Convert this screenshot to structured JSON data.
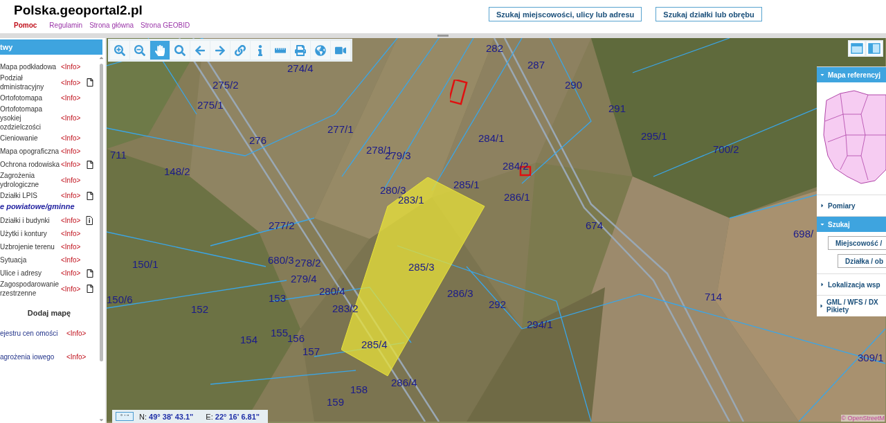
{
  "header": {
    "title": "Polska.geoportal2.pl",
    "links": [
      {
        "label": "Pomoc",
        "kind": "help"
      },
      {
        "label": "Regulamin",
        "kind": "link"
      },
      {
        "label": "Strona główna",
        "kind": "link"
      },
      {
        "label": "Strona GEOBID",
        "kind": "link"
      }
    ],
    "buttons": [
      "Szukaj miejscowości, ulicy lub adresu",
      "Szukaj działki lub obrębu"
    ]
  },
  "sidebar": {
    "title": "twy",
    "items": [
      {
        "kind": "layer",
        "label": "Mapa podkładowa",
        "info": "<Info>",
        "document": false
      },
      {
        "kind": "layer",
        "label": "Podział dministracyjny",
        "info": "<Info>",
        "document": true
      },
      {
        "kind": "layer",
        "label": "Ortofotomapa",
        "info": "<Info>",
        "document": false
      },
      {
        "kind": "layer",
        "label": "Ortofotomapa ysokiej ozdzielczości",
        "info": "<Info>",
        "document": false
      },
      {
        "kind": "layer",
        "label": "Cieniowanie",
        "info": "<Info>",
        "document": false
      },
      {
        "kind": "layer",
        "label": "Mapa opograficzna",
        "info": "<Info>",
        "document": false
      },
      {
        "kind": "layer",
        "label": "Ochrona rodowiska",
        "info": "<Info>",
        "document": true
      },
      {
        "kind": "layer",
        "label": "Zagrożenia ydrologiczne",
        "info": "<Info>",
        "document": false
      },
      {
        "kind": "layer",
        "label": "Działki LPIS",
        "info": "<Info>",
        "document": true
      },
      {
        "kind": "group",
        "label": "e powiatowe/gminne"
      },
      {
        "kind": "infolayer",
        "label": "Działki i budynki",
        "info": "<Info>",
        "document": true
      },
      {
        "kind": "layer",
        "label": "Użytki i kontury",
        "info": "<Info>",
        "document": false
      },
      {
        "kind": "layer",
        "label": "Uzbrojenie terenu",
        "info": "<Info>",
        "document": false
      },
      {
        "kind": "layer",
        "label": "Sytuacja",
        "info": "<Info>",
        "document": false
      },
      {
        "kind": "layer",
        "label": "Ulice i adresy",
        "info": "<Info>",
        "document": true
      },
      {
        "kind": "layer",
        "label": "Zagospodarowanie rzestrzenne",
        "info": "<Info>",
        "document": true
      },
      {
        "kind": "heading",
        "label": "Dodaj mapę"
      },
      {
        "kind": "extra",
        "label": "ejestru cen omości",
        "info": "<Info>"
      },
      {
        "kind": "extra",
        "label": "agrożenia iowego",
        "info": "<Info>"
      }
    ]
  },
  "toolbar": [
    {
      "selected": false
    },
    {
      "selected": false
    },
    {
      "selected": true
    },
    {
      "selected": false
    },
    {
      "selected": false
    },
    {
      "selected": false
    },
    {
      "selected": false
    },
    {
      "selected": false
    },
    {
      "selected": false
    },
    {
      "selected": false
    },
    {
      "selected": false
    },
    {
      "selected": false
    }
  ],
  "map": {
    "parcels": [
      "282",
      "287",
      "274/4",
      "275/2",
      "290",
      "275/1",
      "291",
      "277/1",
      "295/1",
      "276",
      "284/1",
      "711",
      "278/1",
      "279/3",
      "700/2",
      "148/2",
      "284/2",
      "285/1",
      "280/3",
      "286/1",
      "283/1",
      "277/2",
      "674",
      "698/",
      "150/1",
      "680/3",
      "278/2",
      "285/3",
      "279/4",
      "280/4",
      "286/3",
      "153",
      "714",
      "292",
      "152",
      "150/6",
      "283/2",
      "294/1",
      "155",
      "156",
      "154",
      "285/4",
      "157",
      "309/1",
      "286/4",
      "158",
      "159"
    ],
    "attribution": "© OpenStreetM"
  },
  "coordinates": {
    "format": "° ' \"",
    "lat_label": "N:",
    "lat": "49° 38' 43.1\"",
    "lon_label": "E:",
    "lon": "22° 16' 6.81\""
  },
  "right_panel": {
    "sections": [
      {
        "title": "Mapa referencyj",
        "expanded": true,
        "kind": "refmap"
      },
      {
        "title": "Pomiary",
        "expanded": false,
        "kind": "plain"
      },
      {
        "title": "Szukaj",
        "expanded": true,
        "kind": "search",
        "buttons": [
          "Miejscowość /",
          "Działka / ob"
        ]
      },
      {
        "title": "Lokalizacja wsp",
        "expanded": false,
        "kind": "plain"
      },
      {
        "title": "GML / WFS / DX Pikiety",
        "expanded": false,
        "kind": "plain"
      }
    ]
  }
}
